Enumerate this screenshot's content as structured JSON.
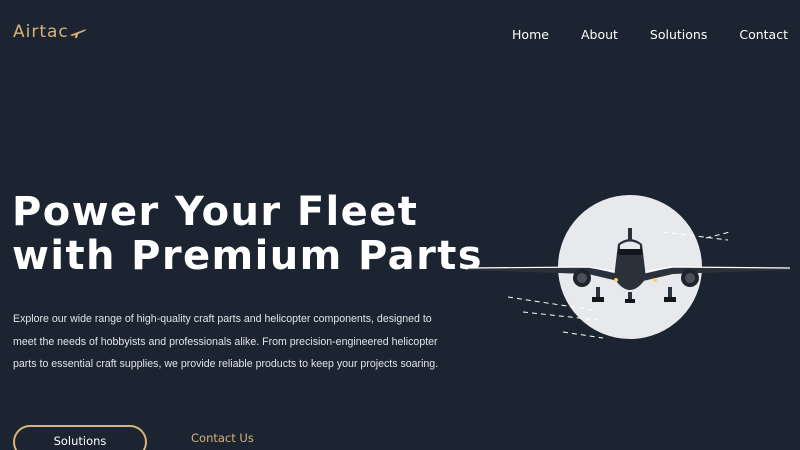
{
  "brand": {
    "name": "Airtac",
    "logo_icon": "airplane-icon",
    "accent": "#d8b27a"
  },
  "nav": {
    "items": [
      "Home",
      "About",
      "Solutions",
      "Contact"
    ]
  },
  "hero": {
    "headline_line1": "Power Your Fleet",
    "headline_line2": "with Premium Parts",
    "description": "Explore our wide range of high-quality craft parts and helicopter components, designed to meet the needs of hobbyists and professionals alike. From precision-engineered helicopter parts to essential craft supplies, we provide reliable products to keep your projects soaring.",
    "primary_cta": "Solutions",
    "secondary_cta": "Contact Us",
    "image": "airplane-front-view-image"
  },
  "colors": {
    "background": "#1b2430",
    "accent": "#d8b27a",
    "text": "#ffffff"
  }
}
